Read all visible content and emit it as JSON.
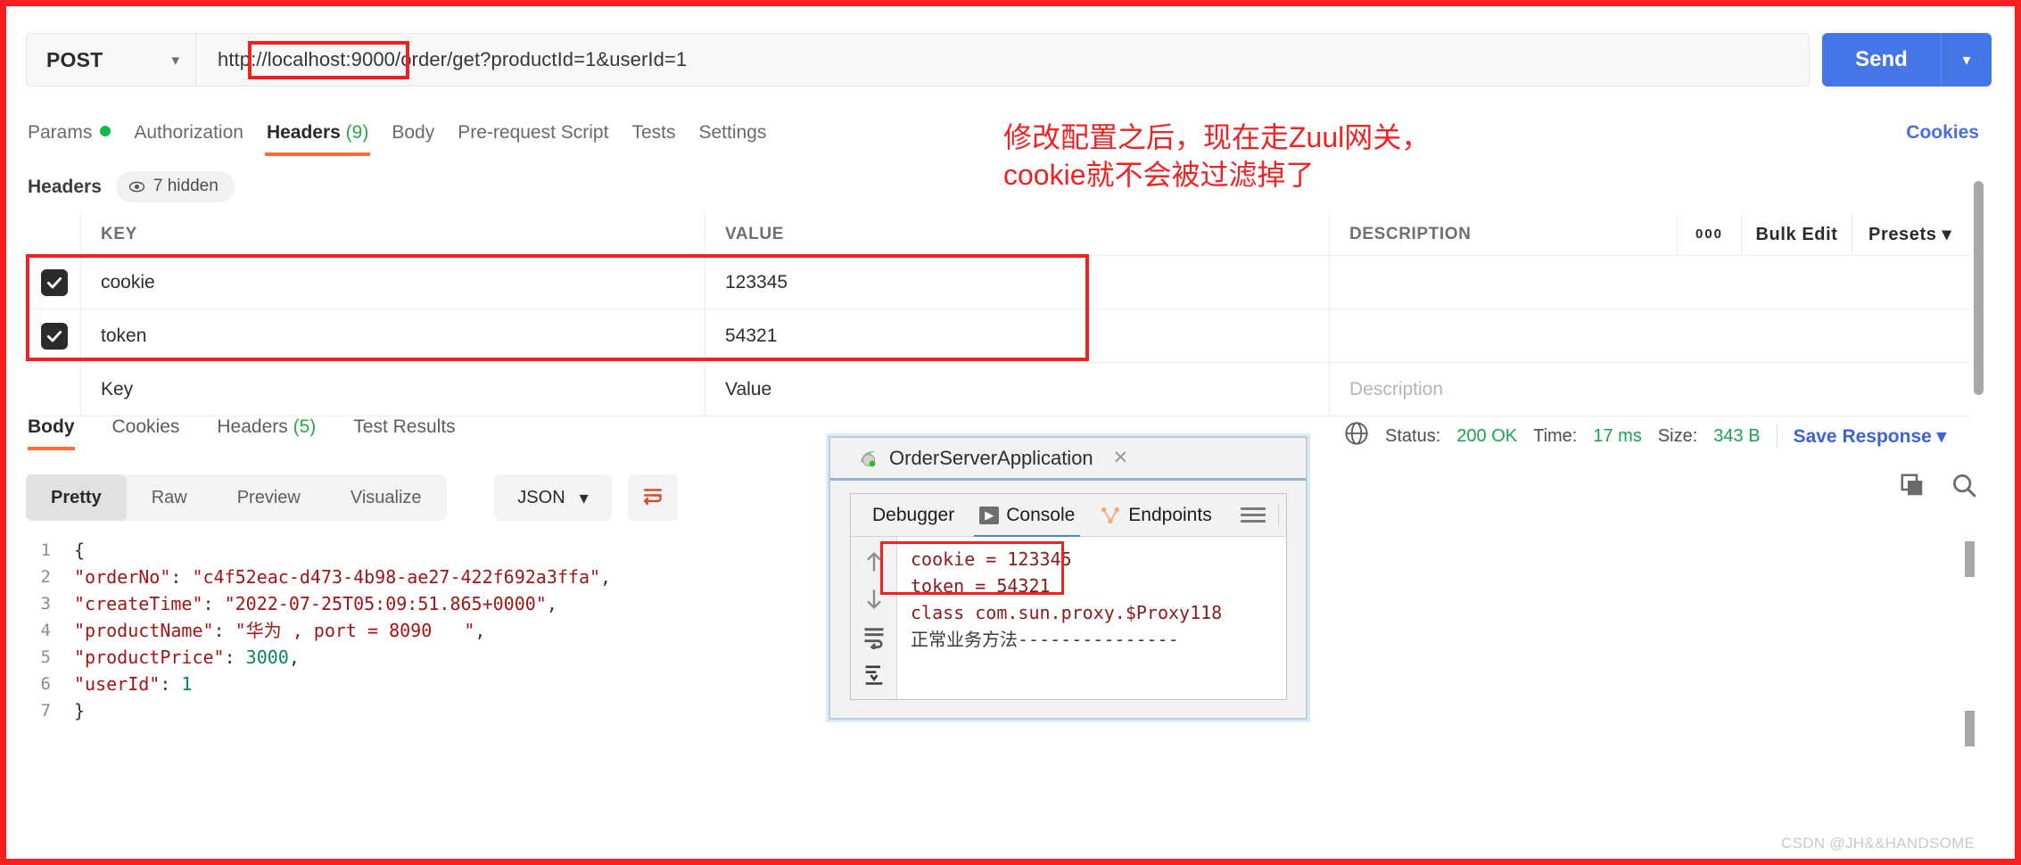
{
  "request": {
    "method": "POST",
    "method_chevron": "chevron-down-icon",
    "url": "http://localhost:9000/order/get?productId=1&userId=1",
    "url_highlight": "//localhost:9000/order/",
    "send_label": "Send",
    "send_chevron": "chevron-down-icon"
  },
  "request_tabs": [
    {
      "label": "Params",
      "badge": "dot",
      "active": false
    },
    {
      "label": "Authorization",
      "badge": "",
      "active": false
    },
    {
      "label": "Headers",
      "count": "(9)",
      "active": true
    },
    {
      "label": "Body",
      "badge": "",
      "active": false
    },
    {
      "label": "Pre-request Script",
      "badge": "",
      "active": false
    },
    {
      "label": "Tests",
      "badge": "",
      "active": false
    },
    {
      "label": "Settings",
      "badge": "",
      "active": false
    }
  ],
  "cookies_link": "Cookies",
  "headers_panel": {
    "title": "Headers",
    "hidden_pill": "7 hidden",
    "eye_icon": "eye-icon",
    "columns": [
      "KEY",
      "VALUE",
      "DESCRIPTION"
    ],
    "tools": {
      "dots": "000",
      "bulk_edit": "Bulk Edit",
      "presets": "Presets",
      "presets_chevron": "chevron-down-icon"
    },
    "rows": [
      {
        "checked": true,
        "key": "cookie",
        "value": "123345",
        "description": ""
      },
      {
        "checked": true,
        "key": "token",
        "value": "54321",
        "description": ""
      }
    ],
    "placeholder_row": {
      "key": "Key",
      "value": "Value",
      "description": "Description"
    }
  },
  "annotation": {
    "text": "修改配置之后，现在走Zuul网关，\ncookie就不会被过滤掉了",
    "color": "#f02222"
  },
  "response_tabs": [
    {
      "label": "Body",
      "active": true
    },
    {
      "label": "Cookies",
      "active": false
    },
    {
      "label": "Headers",
      "count": "(5)",
      "active": false
    },
    {
      "label": "Test Results",
      "active": false
    }
  ],
  "status": {
    "globe_icon": "globe-icon",
    "status_label": "Status:",
    "status_value": "200 OK",
    "time_label": "Time:",
    "time_value": "17 ms",
    "size_label": "Size:",
    "size_value": "343 B",
    "save_response": "Save Response",
    "save_chevron": "chevron-down-icon"
  },
  "view_toolbar": {
    "modes": [
      "Pretty",
      "Raw",
      "Preview",
      "Visualize"
    ],
    "active_mode": "Pretty",
    "format": "JSON",
    "format_chevron": "chevron-down-icon",
    "wrap_icon": "word-wrap-icon",
    "copy_icon": "copy-icon",
    "search_icon": "search-icon"
  },
  "response_body": {
    "lines": [
      {
        "no": "1",
        "segments": [
          {
            "t": "{",
            "c": "brace"
          }
        ],
        "indent": 0
      },
      {
        "no": "2",
        "segments": [
          {
            "t": "\"orderNo\"",
            "c": "k"
          },
          {
            "t": ": ",
            "c": "p"
          },
          {
            "t": "\"c4f52eac-d473-4b98-ae27-422f692a3ffa\"",
            "c": "s"
          },
          {
            "t": ",",
            "c": "p"
          }
        ],
        "indent": 1
      },
      {
        "no": "3",
        "segments": [
          {
            "t": "\"createTime\"",
            "c": "k"
          },
          {
            "t": ": ",
            "c": "p"
          },
          {
            "t": "\"2022-07-25T05:09:51.865+0000\"",
            "c": "s"
          },
          {
            "t": ",",
            "c": "p"
          }
        ],
        "indent": 1
      },
      {
        "no": "4",
        "segments": [
          {
            "t": "\"productName\"",
            "c": "k"
          },
          {
            "t": ": ",
            "c": "p"
          },
          {
            "t": "\"华为 , port = 8090   \"",
            "c": "s"
          },
          {
            "t": ",",
            "c": "p"
          }
        ],
        "indent": 1
      },
      {
        "no": "5",
        "segments": [
          {
            "t": "\"productPrice\"",
            "c": "k"
          },
          {
            "t": ": ",
            "c": "p"
          },
          {
            "t": "3000",
            "c": "n"
          },
          {
            "t": ",",
            "c": "p"
          }
        ],
        "indent": 1
      },
      {
        "no": "6",
        "segments": [
          {
            "t": "\"userId\"",
            "c": "k"
          },
          {
            "t": ": ",
            "c": "p"
          },
          {
            "t": "1",
            "c": "n"
          }
        ],
        "indent": 1
      },
      {
        "no": "7",
        "segments": [
          {
            "t": "}",
            "c": "brace"
          }
        ],
        "indent": 0
      }
    ]
  },
  "idea_overlay": {
    "tab_title": "OrderServerApplication",
    "tab_icon": "spring-boot-icon",
    "tab_close": "close-icon",
    "tool_tabs": [
      {
        "label": "Debugger",
        "icon": "",
        "selected": false
      },
      {
        "label": "Console",
        "icon": "run-icon",
        "selected": true
      },
      {
        "label": "Endpoints",
        "icon": "endpoints-icon",
        "selected": false
      }
    ],
    "menu_icon": "hamburger-icon",
    "side_icons": [
      "arrow-up-icon",
      "arrow-down-icon",
      "soft-wrap-icon",
      "scroll-to-end-icon"
    ],
    "console_lines": [
      {
        "text": "cookie = 123345",
        "style": "red",
        "boxed": true
      },
      {
        "text": "token = 54321",
        "style": "red",
        "boxed": true
      },
      {
        "text": "class com.sun.proxy.$Proxy118",
        "style": "red",
        "boxed": false
      },
      {
        "text": "正常业务方法---------------",
        "style": "dark",
        "boxed": false
      }
    ]
  },
  "watermark": "CSDN @JH&&HANDSOME"
}
